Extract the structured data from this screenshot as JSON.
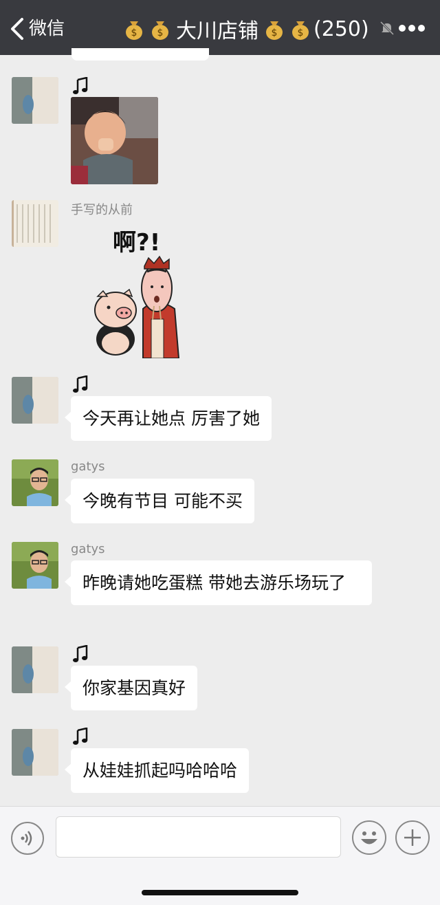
{
  "header": {
    "back_label": "微信",
    "chat_title": "大川店铺",
    "member_count": "(250)",
    "icons": [
      "chevron-left-icon",
      "money-bag-icon",
      "mute-icon",
      "more-icon"
    ]
  },
  "messages": [
    {
      "type": "image",
      "sender": "",
      "sender_icon": "music-note-icon",
      "content": "photo of laughing toddler"
    },
    {
      "type": "sticker",
      "sender": "手写的从前",
      "sticker_text": "啊?!"
    },
    {
      "type": "text",
      "sender": "",
      "sender_icon": "music-note-icon",
      "text": "今天再让她点 厉害了她"
    },
    {
      "type": "text",
      "sender": "gatys",
      "text": "今晚有节目  可能不买"
    },
    {
      "type": "text",
      "sender": "gatys",
      "text": "昨晚请她吃蛋糕  带她去游乐场玩了"
    },
    {
      "type": "text",
      "sender": "",
      "sender_icon": "music-note-icon",
      "text": "你家基因真好"
    },
    {
      "type": "text",
      "sender": "",
      "sender_icon": "music-note-icon",
      "text": "从娃娃抓起吗哈哈哈"
    }
  ],
  "input_bar": {
    "placeholder": "",
    "icons": [
      "voice-icon",
      "emoji-icon",
      "plus-icon"
    ]
  },
  "colors": {
    "topbar": "#393a3f",
    "chat_bg": "#ededed",
    "bubble": "#ffffff"
  }
}
